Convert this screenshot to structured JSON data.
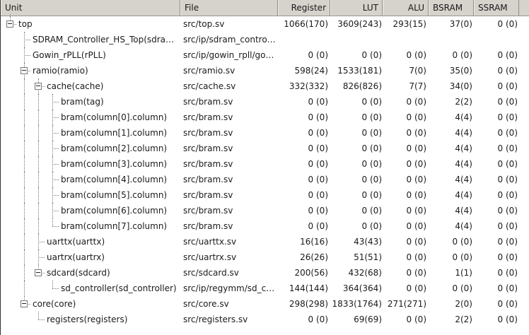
{
  "columns": {
    "unit": "Unit",
    "file": "File",
    "register": "Register",
    "lut": "LUT",
    "alu": "ALU",
    "bsram": "BSRAM",
    "ssram": "SSRAM"
  },
  "rows": [
    {
      "level": 0,
      "expandable": true,
      "unit": "top",
      "file": "src/top.sv",
      "register": "1066(170)",
      "lut": "3609(243)",
      "alu": "293(15)",
      "bsram": "37(0)",
      "ssram": "0 (0)"
    },
    {
      "level": 1,
      "expandable": false,
      "unit": "SDRAM_Controller_HS_Top(sdram_controller)",
      "file": "src/ip/sdram_controller",
      "register": "",
      "lut": "",
      "alu": "",
      "bsram": "",
      "ssram": ""
    },
    {
      "level": 1,
      "expandable": false,
      "unit": "Gowin_rPLL(rPLL)",
      "file": "src/ip/gowin_rpll/gowin_rpll.v",
      "register": "0 (0)",
      "lut": "0 (0)",
      "alu": "0 (0)",
      "bsram": "0 (0)",
      "ssram": "0 (0)"
    },
    {
      "level": 1,
      "expandable": true,
      "unit": "ramio(ramio)",
      "file": "src/ramio.sv",
      "register": "598(24)",
      "lut": "1533(181)",
      "alu": "7(0)",
      "bsram": "35(0)",
      "ssram": "0 (0)"
    },
    {
      "level": 2,
      "expandable": true,
      "unit": "cache(cache)",
      "file": "src/cache.sv",
      "register": "332(332)",
      "lut": "826(826)",
      "alu": "7(7)",
      "bsram": "34(0)",
      "ssram": "0 (0)"
    },
    {
      "level": 3,
      "expandable": false,
      "unit": "bram(tag)",
      "file": "src/bram.sv",
      "register": "0 (0)",
      "lut": "0 (0)",
      "alu": "0 (0)",
      "bsram": "2(2)",
      "ssram": "0 (0)"
    },
    {
      "level": 3,
      "expandable": false,
      "unit": "bram(column[0].column)",
      "file": "src/bram.sv",
      "register": "0 (0)",
      "lut": "0 (0)",
      "alu": "0 (0)",
      "bsram": "4(4)",
      "ssram": "0 (0)"
    },
    {
      "level": 3,
      "expandable": false,
      "unit": "bram(column[1].column)",
      "file": "src/bram.sv",
      "register": "0 (0)",
      "lut": "0 (0)",
      "alu": "0 (0)",
      "bsram": "4(4)",
      "ssram": "0 (0)"
    },
    {
      "level": 3,
      "expandable": false,
      "unit": "bram(column[2].column)",
      "file": "src/bram.sv",
      "register": "0 (0)",
      "lut": "0 (0)",
      "alu": "0 (0)",
      "bsram": "4(4)",
      "ssram": "0 (0)"
    },
    {
      "level": 3,
      "expandable": false,
      "unit": "bram(column[3].column)",
      "file": "src/bram.sv",
      "register": "0 (0)",
      "lut": "0 (0)",
      "alu": "0 (0)",
      "bsram": "4(4)",
      "ssram": "0 (0)"
    },
    {
      "level": 3,
      "expandable": false,
      "unit": "bram(column[4].column)",
      "file": "src/bram.sv",
      "register": "0 (0)",
      "lut": "0 (0)",
      "alu": "0 (0)",
      "bsram": "4(4)",
      "ssram": "0 (0)"
    },
    {
      "level": 3,
      "expandable": false,
      "unit": "bram(column[5].column)",
      "file": "src/bram.sv",
      "register": "0 (0)",
      "lut": "0 (0)",
      "alu": "0 (0)",
      "bsram": "4(4)",
      "ssram": "0 (0)"
    },
    {
      "level": 3,
      "expandable": false,
      "unit": "bram(column[6].column)",
      "file": "src/bram.sv",
      "register": "0 (0)",
      "lut": "0 (0)",
      "alu": "0 (0)",
      "bsram": "4(4)",
      "ssram": "0 (0)"
    },
    {
      "level": 3,
      "expandable": false,
      "unit": "bram(column[7].column)",
      "file": "src/bram.sv",
      "register": "0 (0)",
      "lut": "0 (0)",
      "alu": "0 (0)",
      "bsram": "4(4)",
      "ssram": "0 (0)"
    },
    {
      "level": 2,
      "expandable": false,
      "unit": "uarttx(uarttx)",
      "file": "src/uarttx.sv",
      "register": "16(16)",
      "lut": "43(43)",
      "alu": "0 (0)",
      "bsram": "0 (0)",
      "ssram": "0 (0)"
    },
    {
      "level": 2,
      "expandable": false,
      "unit": "uartrx(uartrx)",
      "file": "src/uartrx.sv",
      "register": "26(26)",
      "lut": "51(51)",
      "alu": "0 (0)",
      "bsram": "0 (0)",
      "ssram": "0 (0)"
    },
    {
      "level": 2,
      "expandable": true,
      "unit": "sdcard(sdcard)",
      "file": "src/sdcard.sv",
      "register": "200(56)",
      "lut": "432(68)",
      "alu": "0 (0)",
      "bsram": "1(1)",
      "ssram": "0 (0)"
    },
    {
      "level": 3,
      "expandable": false,
      "unit": "sd_controller(sd_controller)",
      "file": "src/ip/regymm/sd_controller.v",
      "register": "144(144)",
      "lut": "364(364)",
      "alu": "0 (0)",
      "bsram": "0 (0)",
      "ssram": "0 (0)"
    },
    {
      "level": 1,
      "expandable": true,
      "unit": "core(core)",
      "file": "src/core.sv",
      "register": "298(298)",
      "lut": "1833(1764)",
      "alu": "271(271)",
      "bsram": "2(0)",
      "ssram": "0 (0)"
    },
    {
      "level": 2,
      "expandable": false,
      "unit": "registers(registers)",
      "file": "src/registers.sv",
      "register": "0 (0)",
      "lut": "69(69)",
      "alu": "0 (0)",
      "bsram": "2(2)",
      "ssram": "0 (0)"
    }
  ]
}
